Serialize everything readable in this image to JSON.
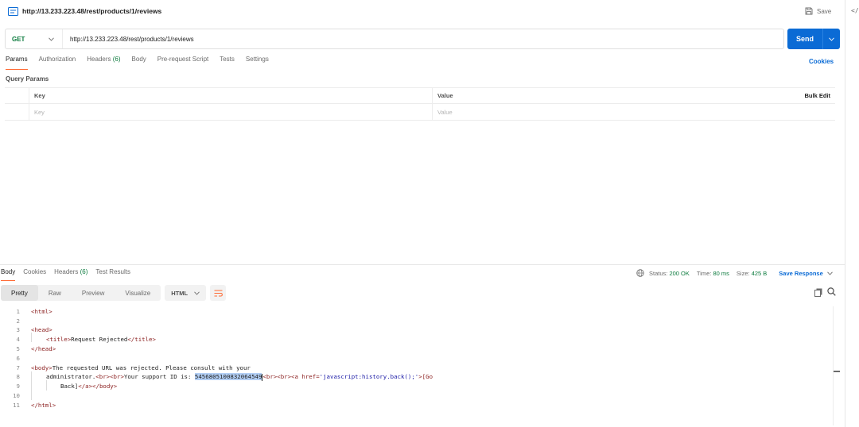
{
  "header": {
    "title": "http://13.233.223.48/rest/products/1/reviews",
    "save_label": "Save",
    "code_toggle_label": "</"
  },
  "request": {
    "method": "GET",
    "url": "http://13.233.223.48/rest/products/1/reviews",
    "send_label": "Send"
  },
  "request_tabs": [
    {
      "label": "Params",
      "active": true
    },
    {
      "label": "Authorization"
    },
    {
      "label": "Headers",
      "count": "(6)"
    },
    {
      "label": "Body"
    },
    {
      "label": "Pre-request Script"
    },
    {
      "label": "Tests"
    },
    {
      "label": "Settings"
    }
  ],
  "cookies_label": "Cookies",
  "query_params": {
    "section_label": "Query Params",
    "key_header": "Key",
    "value_header": "Value",
    "bulk_edit_label": "Bulk Edit",
    "key_placeholder": "Key",
    "value_placeholder": "Value"
  },
  "response_tabs": [
    {
      "label": "Body",
      "active": true
    },
    {
      "label": "Cookies"
    },
    {
      "label": "Headers",
      "count": "(6)"
    },
    {
      "label": "Test Results"
    }
  ],
  "response_meta": {
    "status_label": "Status:",
    "status_value": "200 OK",
    "time_label": "Time:",
    "time_value": "80 ms",
    "size_label": "Size:",
    "size_value": "425 B",
    "save_response_label": "Save Response"
  },
  "format_tabs": [
    {
      "label": "Pretty",
      "active": true
    },
    {
      "label": "Raw"
    },
    {
      "label": "Preview"
    },
    {
      "label": "Visualize"
    }
  ],
  "language": "HTML",
  "code_lines": {
    "n1": "1",
    "n2": "2",
    "n3": "3",
    "n4": "4",
    "n5": "5",
    "n6": "6",
    "n7": "7",
    "n8": "8",
    "n9": "9",
    "n10": "10",
    "n11": "11",
    "l1": "<html>",
    "l3": "<head>",
    "l4_open": "<title>",
    "l4_text": "Request Rejected",
    "l4_close": "</title>",
    "l5": "</head>",
    "l7_tag": "<body>",
    "l7_text": "The requested URL was rejected. Please consult with your",
    "l8_a": "administrator.",
    "l8_b": "<br><br>",
    "l8_c": "Your support ID is: ",
    "l8_id": "5456805100832064549",
    "l8_d": "<br><br><a ",
    "l8_attr": "href=",
    "l8_str": "'javascript:history.back();'",
    "l8_e": ">[Go",
    "l9_text": "Back]",
    "l9_tags": "</a></body>",
    "l11": "</html>"
  }
}
